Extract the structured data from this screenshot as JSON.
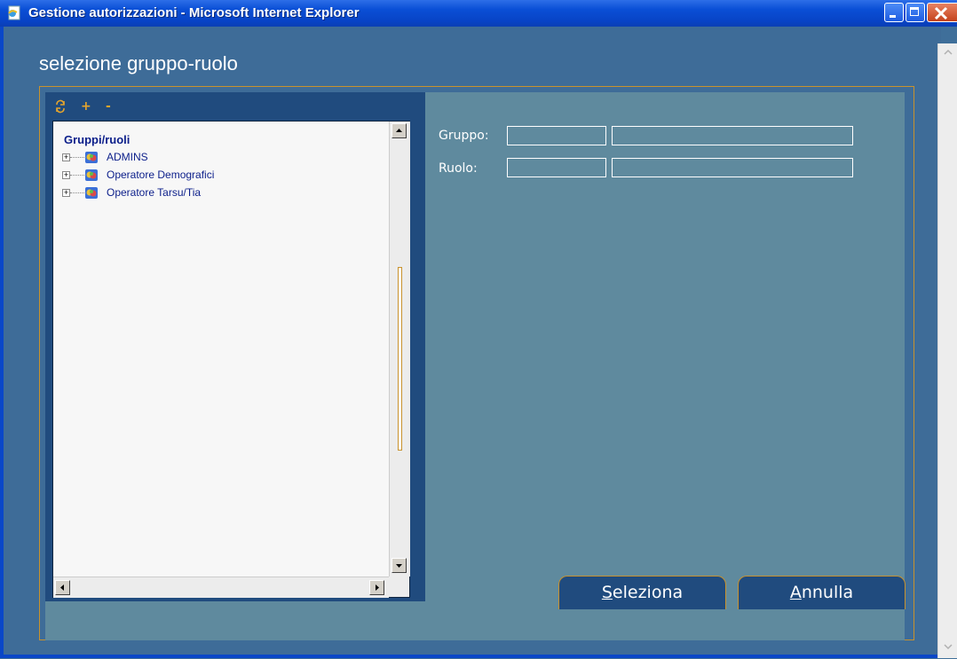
{
  "window": {
    "title": "Gestione autorizzazioni - Microsoft Internet Explorer",
    "controls": [
      "minimize-icon",
      "maximize-icon",
      "close-icon"
    ]
  },
  "page": {
    "title": "selezione gruppo-ruolo"
  },
  "toolbar": {
    "icons": [
      "refresh-icon",
      "expand-all-icon",
      "collapse-all-icon"
    ],
    "expand_glyph": "+",
    "collapse_glyph": "-"
  },
  "tree": {
    "root_label": "Gruppi/ruoli",
    "items": [
      {
        "label": "ADMINS",
        "expander": "+"
      },
      {
        "label": "Operatore Demografici",
        "expander": "+"
      },
      {
        "label": "Operatore Tarsu/Tia",
        "expander": "+"
      }
    ]
  },
  "form": {
    "gruppo_label": "Gruppo:",
    "ruolo_label": "Ruolo:",
    "gruppo_code": "",
    "gruppo_desc": "",
    "ruolo_code": "",
    "ruolo_desc": ""
  },
  "buttons": {
    "seleziona_key": "S",
    "seleziona_rest": "eleziona",
    "annulla_key": "A",
    "annulla_rest": "nnulla"
  },
  "colors": {
    "titlebar": "#0a4fd6",
    "page_bg": "#3e6c98",
    "panel_dark": "#204b7e",
    "panel_light": "#5f8a9e",
    "accent": "#c8922d"
  }
}
